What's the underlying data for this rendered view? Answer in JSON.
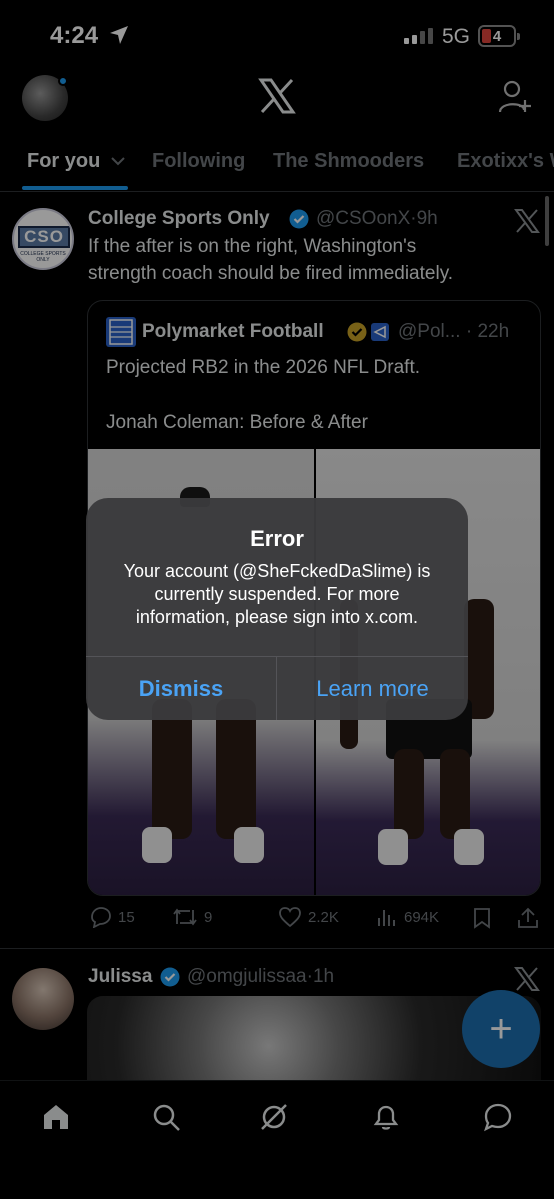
{
  "status_bar": {
    "time": "4:24",
    "network": "5G",
    "battery": "4",
    "battery_color": "#e0453d",
    "icons": [
      "location-arrow-icon",
      "signal-icon",
      "battery-icon"
    ]
  },
  "header": {
    "logo": "x-logo-icon",
    "right_icon": "add-user-icon"
  },
  "tabs": [
    {
      "label": "For you"
    },
    {
      "label": "Following"
    },
    {
      "label": "The Shmooders"
    },
    {
      "label": "Exotixx's W"
    }
  ],
  "post1": {
    "avatar_text": "CSO",
    "avatar_subtext": "COLLEGE SPORTS ONLY",
    "author": "College Sports Only",
    "handle": "@CSOonX",
    "time": "9h",
    "text_line1": "If the after is on the right, Washington's",
    "text_line2": "strength coach should be fired immediately.",
    "quote": {
      "author": "Polymarket Football",
      "handle": "@Pol...",
      "time": "22h",
      "text1": "Projected RB2 in the 2026 NFL Draft.",
      "text2": "Jonah Coleman: Before & After"
    },
    "actions": {
      "replies": "15",
      "reposts": "9",
      "likes": "2.2K",
      "views": "694K"
    }
  },
  "post2": {
    "author": "Julissa",
    "handle": "@omgjulissaa",
    "time": "1h"
  },
  "fab": {
    "label": "+"
  },
  "bottom_nav": [
    "home-icon",
    "search-icon",
    "grok-icon",
    "notifications-icon",
    "messages-icon"
  ],
  "alert": {
    "title": "Error",
    "message": "Your account (@SheFckedDaSlime) is currently suspended. For more information, please sign into x.com.",
    "dismiss": "Dismiss",
    "learn_more": "Learn more"
  },
  "colors": {
    "accent": "#1d9bf0",
    "link": "#4aa3f5",
    "muted": "#71767b"
  }
}
